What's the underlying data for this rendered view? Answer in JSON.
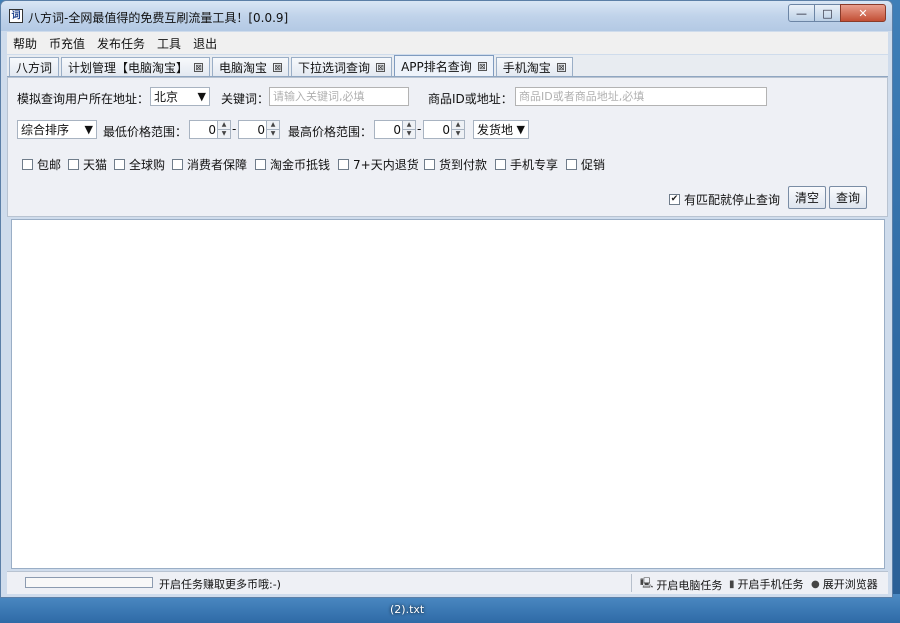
{
  "window": {
    "title": "八方词-全网最值得的免费互刷流量工具！[0.0.9]",
    "app_icon_glyph": "词",
    "controls": {
      "minimize": "—",
      "maximize": "□",
      "close": "✕"
    }
  },
  "menu": [
    "帮助",
    "币充值",
    "发布任务",
    "工具",
    "退出"
  ],
  "tabs": [
    {
      "label": "八方词",
      "closable": false,
      "active": false
    },
    {
      "label": "计划管理【电脑淘宝】",
      "closable": true,
      "active": false
    },
    {
      "label": "电脑淘宝",
      "closable": true,
      "active": false
    },
    {
      "label": "下拉选词查询",
      "closable": true,
      "active": false
    },
    {
      "label": "APP排名查询",
      "closable": true,
      "active": true
    },
    {
      "label": "手机淘宝",
      "closable": true,
      "active": false
    }
  ],
  "tab_close_glyph": "⊠",
  "form": {
    "location_label": "模拟查询用户所在地址：",
    "location_value": "北京",
    "keyword_label": "关键词：",
    "keyword_placeholder": "请输入关键词,必填",
    "product_label": "商品ID或地址：",
    "product_placeholder": "商品ID或者商品地址,必填",
    "sort_value": "综合排序",
    "min_price_label": "最低价格范围：",
    "min_price_from": "0",
    "min_price_to": "0",
    "max_price_label": "最高价格范围：",
    "max_price_from": "0",
    "max_price_to": "0",
    "dash": "-",
    "ship_from_value": "发货地",
    "filters": [
      {
        "label": "包邮",
        "checked": false
      },
      {
        "label": "天猫",
        "checked": false
      },
      {
        "label": "全球购",
        "checked": false
      },
      {
        "label": "消费者保障",
        "checked": false
      },
      {
        "label": "淘金币抵钱",
        "checked": false
      },
      {
        "label": "7+天内退货",
        "checked": false
      },
      {
        "label": "货到付款",
        "checked": false
      },
      {
        "label": "手机专享",
        "checked": false
      },
      {
        "label": "促销",
        "checked": false
      }
    ],
    "stop_on_match_label": "有匹配就停止查询",
    "stop_on_match_checked": true,
    "clear_button": "清空",
    "query_button": "查询"
  },
  "status": {
    "progress": 0,
    "message": "开启任务赚取更多币哦:-)",
    "pc_task": "开启电脑任务",
    "mobile_task": "开启手机任务",
    "browser": "展开浏览器"
  },
  "desktop": {
    "taskbar_label": "(2).txt"
  }
}
